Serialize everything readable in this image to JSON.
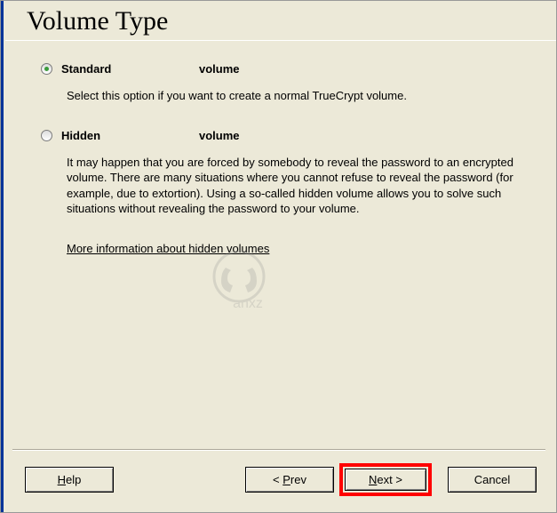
{
  "header": {
    "title": "Volume Type"
  },
  "options": {
    "standard": {
      "label_part1": "Standard",
      "label_part2": "volume",
      "description": "Select this option if you want to create a normal TrueCrypt volume.",
      "selected": true
    },
    "hidden": {
      "label_part1": "Hidden",
      "label_part2": "volume",
      "description": "It may happen that you are forced by somebody to reveal the password to an encrypted volume. There are many situations where you cannot refuse to reveal the password (for example, due to extortion). Using a so-called hidden volume allows you to solve such situations without revealing the password to your volume.",
      "selected": false
    }
  },
  "more_info": "More information about hidden volumes",
  "buttons": {
    "help_prefix": "H",
    "help_suffix": "elp",
    "prev_prefix": "< ",
    "prev_ul": "P",
    "prev_suffix": "rev",
    "next_ul": "N",
    "next_suffix": "ext >",
    "cancel": "Cancel"
  },
  "watermark": "anxz"
}
